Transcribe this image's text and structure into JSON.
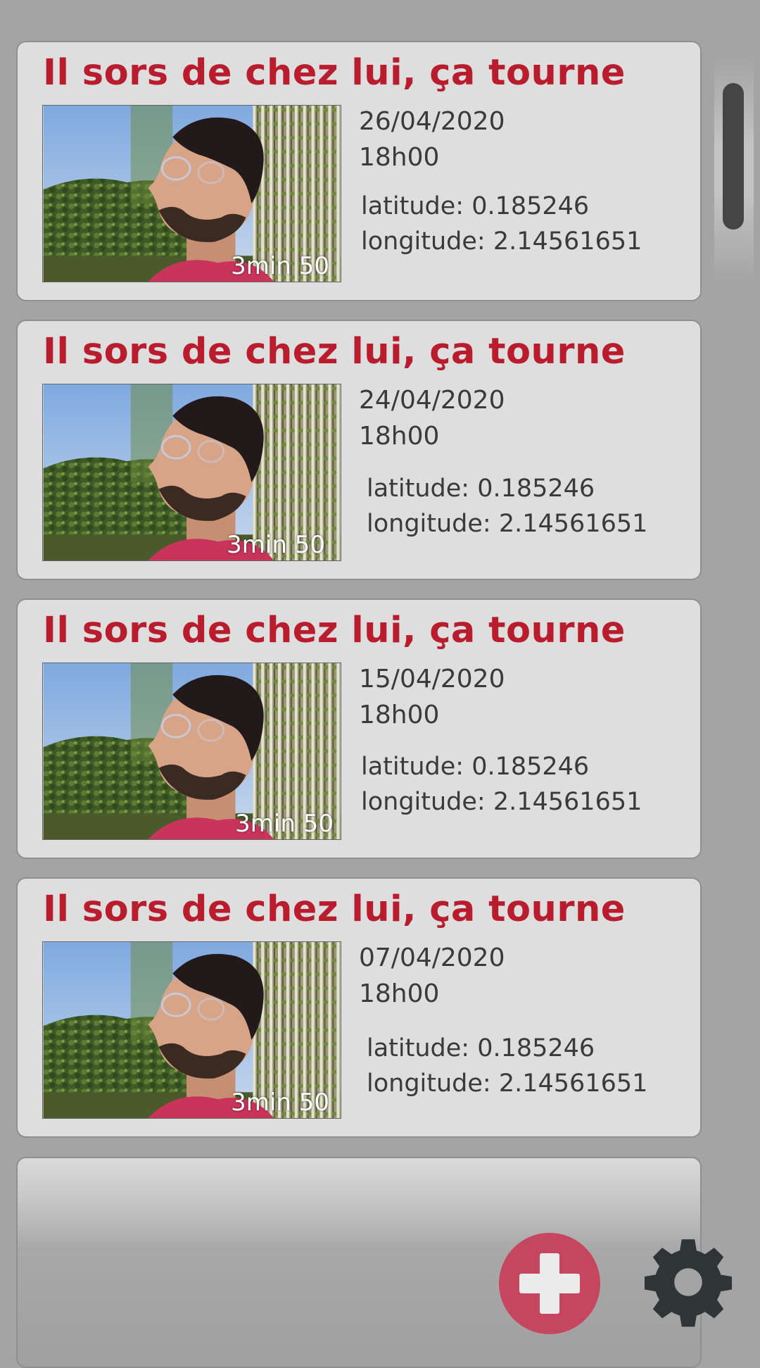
{
  "feed": {
    "items": [
      {
        "title": "Il sors de chez lui, ça tourne",
        "date": "26/04/2020",
        "time": "18h00",
        "latitude": "latitude: 0.185246",
        "longitude": "longitude: 2.14561651",
        "duration": "3min 50"
      },
      {
        "title": "Il sors de chez lui, ça tourne",
        "date": "24/04/2020",
        "time": "18h00",
        "latitude": "latitude: 0.185246",
        "longitude": "longitude: 2.14561651",
        "duration": "3min 50"
      },
      {
        "title": "Il sors de chez lui, ça tourne",
        "date": "15/04/2020",
        "time": "18h00",
        "latitude": "latitude: 0.185246",
        "longitude": "longitude: 2.14561651",
        "duration": "3min 50"
      },
      {
        "title": "Il sors de chez lui, ça tourne",
        "date": "07/04/2020",
        "time": "18h00",
        "latitude": "latitude: 0.185246",
        "longitude": "longitude: 2.14561651",
        "duration": "3min 50"
      }
    ]
  },
  "actions": {
    "add_icon": "plus-icon",
    "settings_icon": "gear-icon"
  },
  "colors": {
    "title": "#b81c2d",
    "add_button": "#c6455f",
    "card": "#dedede",
    "background": "#a4a4a4"
  }
}
